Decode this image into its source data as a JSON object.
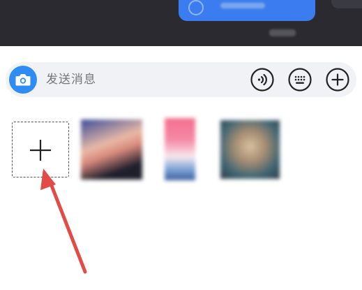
{
  "input_bar": {
    "placeholder": "发送消息",
    "camera_icon": "camera-icon",
    "voice_icon": "voice-icon",
    "keyboard_icon": "keyboard-icon",
    "more_icon": "plus-circle-icon"
  },
  "media_picker": {
    "add_icon": "plus-icon",
    "thumbnails": [
      "photo-thumbnail",
      "photo-thumbnail",
      "photo-thumbnail"
    ]
  },
  "annotation": {
    "icon": "red-arrow-icon"
  },
  "colors": {
    "accent": "#2f8cf5",
    "bubble": "#3b7df0",
    "top_background": "#2a2a30",
    "annotation": "#e34b47"
  }
}
